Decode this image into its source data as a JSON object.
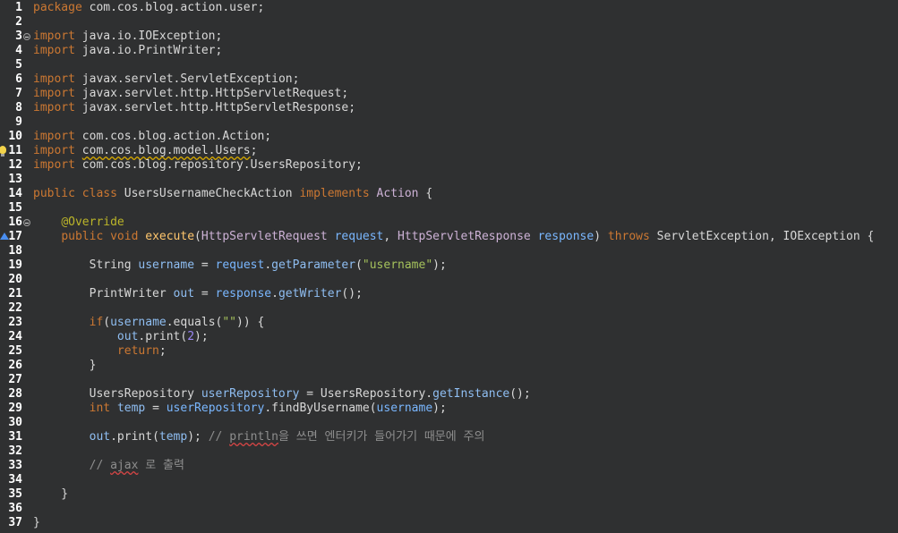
{
  "editor": {
    "language": "java",
    "colors": {
      "background": "#2f3031",
      "keyword": "#cc7832",
      "string": "#a5c25c",
      "comment": "#8e8e8e",
      "parameter": "#7ab7ff",
      "method": "#ffc66d",
      "annotation": "#bbb529",
      "number": "#9b87f5"
    },
    "lines": [
      {
        "n": "1",
        "t": [
          [
            "kw",
            "package"
          ],
          [
            "plain",
            " com.cos.blog.action.user;"
          ]
        ]
      },
      {
        "n": "2",
        "t": []
      },
      {
        "n": "3",
        "fold": true,
        "t": [
          [
            "kw",
            "import"
          ],
          [
            "plain",
            " java.io.IOException;"
          ]
        ]
      },
      {
        "n": "4",
        "t": [
          [
            "kw",
            "import"
          ],
          [
            "plain",
            " java.io.PrintWriter;"
          ]
        ]
      },
      {
        "n": "5",
        "t": []
      },
      {
        "n": "6",
        "t": [
          [
            "kw",
            "import"
          ],
          [
            "plain",
            " javax.servlet.ServletException;"
          ]
        ]
      },
      {
        "n": "7",
        "t": [
          [
            "kw",
            "import"
          ],
          [
            "plain",
            " javax.servlet.http.HttpServletRequest;"
          ]
        ]
      },
      {
        "n": "8",
        "t": [
          [
            "kw",
            "import"
          ],
          [
            "plain",
            " javax.servlet.http.HttpServletResponse;"
          ]
        ]
      },
      {
        "n": "9",
        "t": []
      },
      {
        "n": "10",
        "t": [
          [
            "kw",
            "import"
          ],
          [
            "plain",
            " com.cos.blog.action.Action;"
          ]
        ]
      },
      {
        "n": "11",
        "marker": "warning-bulb",
        "t": [
          [
            "kw",
            "import"
          ],
          [
            "plain",
            " "
          ],
          [
            "warn",
            "com.cos.blog.model.Users"
          ],
          [
            "plain",
            ";"
          ]
        ]
      },
      {
        "n": "12",
        "t": [
          [
            "kw",
            "import"
          ],
          [
            "plain",
            " com.cos.blog.repository.UsersRepository;"
          ]
        ]
      },
      {
        "n": "13",
        "t": []
      },
      {
        "n": "14",
        "t": [
          [
            "kw",
            "public"
          ],
          [
            "plain",
            " "
          ],
          [
            "kw",
            "class"
          ],
          [
            "plain",
            " UsersUsernameCheckAction "
          ],
          [
            "kw",
            "implements"
          ],
          [
            "plain",
            " "
          ],
          [
            "cls",
            "Action"
          ],
          [
            "plain",
            " {"
          ]
        ]
      },
      {
        "n": "15",
        "t": []
      },
      {
        "n": "16",
        "fold": true,
        "t": [
          [
            "plain",
            "    "
          ],
          [
            "ann",
            "@Override"
          ]
        ]
      },
      {
        "n": "17",
        "marker": "override-arrow",
        "t": [
          [
            "plain",
            "    "
          ],
          [
            "kw",
            "public"
          ],
          [
            "plain",
            " "
          ],
          [
            "kw",
            "void"
          ],
          [
            "plain",
            " "
          ],
          [
            "meth",
            "execute"
          ],
          [
            "plain",
            "("
          ],
          [
            "cls",
            "HttpServletRequest"
          ],
          [
            "plain",
            " "
          ],
          [
            "param",
            "request"
          ],
          [
            "plain",
            ", "
          ],
          [
            "cls",
            "HttpServletResponse"
          ],
          [
            "plain",
            " "
          ],
          [
            "param",
            "response"
          ],
          [
            "plain",
            ") "
          ],
          [
            "kw",
            "throws"
          ],
          [
            "plain",
            " ServletException, IOException {"
          ]
        ]
      },
      {
        "n": "18",
        "t": []
      },
      {
        "n": "19",
        "t": [
          [
            "plain",
            "        String "
          ],
          [
            "fld",
            "username"
          ],
          [
            "plain",
            " = "
          ],
          [
            "param",
            "request"
          ],
          [
            "plain",
            "."
          ],
          [
            "fld",
            "getParameter"
          ],
          [
            "plain",
            "("
          ],
          [
            "str",
            "\"username\""
          ],
          [
            "plain",
            ");"
          ]
        ]
      },
      {
        "n": "20",
        "t": []
      },
      {
        "n": "21",
        "t": [
          [
            "plain",
            "        PrintWriter "
          ],
          [
            "fld",
            "out"
          ],
          [
            "plain",
            " = "
          ],
          [
            "param",
            "response"
          ],
          [
            "plain",
            "."
          ],
          [
            "fld",
            "getWriter"
          ],
          [
            "plain",
            "();"
          ]
        ]
      },
      {
        "n": "22",
        "t": []
      },
      {
        "n": "23",
        "t": [
          [
            "plain",
            "        "
          ],
          [
            "kw",
            "if"
          ],
          [
            "plain",
            "("
          ],
          [
            "fld",
            "username"
          ],
          [
            "plain",
            ".equals("
          ],
          [
            "str",
            "\"\""
          ],
          [
            "plain",
            ")) {"
          ]
        ]
      },
      {
        "n": "24",
        "t": [
          [
            "plain",
            "            "
          ],
          [
            "fld",
            "out"
          ],
          [
            "plain",
            ".print("
          ],
          [
            "num",
            "2"
          ],
          [
            "plain",
            ");"
          ]
        ]
      },
      {
        "n": "25",
        "t": [
          [
            "plain",
            "            "
          ],
          [
            "kw",
            "return"
          ],
          [
            "plain",
            ";"
          ]
        ]
      },
      {
        "n": "26",
        "t": [
          [
            "plain",
            "        }"
          ]
        ]
      },
      {
        "n": "27",
        "t": []
      },
      {
        "n": "28",
        "t": [
          [
            "plain",
            "        UsersRepository "
          ],
          [
            "fld",
            "userRepository"
          ],
          [
            "plain",
            " = UsersRepository."
          ],
          [
            "fld",
            "getInstance"
          ],
          [
            "plain",
            "();"
          ]
        ]
      },
      {
        "n": "29",
        "t": [
          [
            "plain",
            "        "
          ],
          [
            "kw",
            "int"
          ],
          [
            "plain",
            " "
          ],
          [
            "fld",
            "temp"
          ],
          [
            "plain",
            " = "
          ],
          [
            "param",
            "userRepository"
          ],
          [
            "plain",
            ".findByUsername("
          ],
          [
            "param",
            "username"
          ],
          [
            "plain",
            ");"
          ]
        ]
      },
      {
        "n": "30",
        "t": []
      },
      {
        "n": "31",
        "t": [
          [
            "plain",
            "        "
          ],
          [
            "fld",
            "out"
          ],
          [
            "plain",
            ".print("
          ],
          [
            "fld",
            "temp"
          ],
          [
            "plain",
            "); "
          ],
          [
            "cmt",
            "// "
          ],
          [
            "cmterr",
            "println"
          ],
          [
            "cmt",
            "을 쓰면 엔터키가 들어가기 때문에 주의"
          ]
        ]
      },
      {
        "n": "32",
        "t": []
      },
      {
        "n": "33",
        "t": [
          [
            "plain",
            "        "
          ],
          [
            "cmt",
            "// "
          ],
          [
            "cmterr",
            "ajax"
          ],
          [
            "cmt",
            " 로 출력"
          ]
        ]
      },
      {
        "n": "34",
        "t": []
      },
      {
        "n": "35",
        "t": [
          [
            "plain",
            "    }"
          ]
        ]
      },
      {
        "n": "36",
        "t": []
      },
      {
        "n": "37",
        "t": [
          [
            "plain",
            "}"
          ]
        ]
      }
    ]
  }
}
